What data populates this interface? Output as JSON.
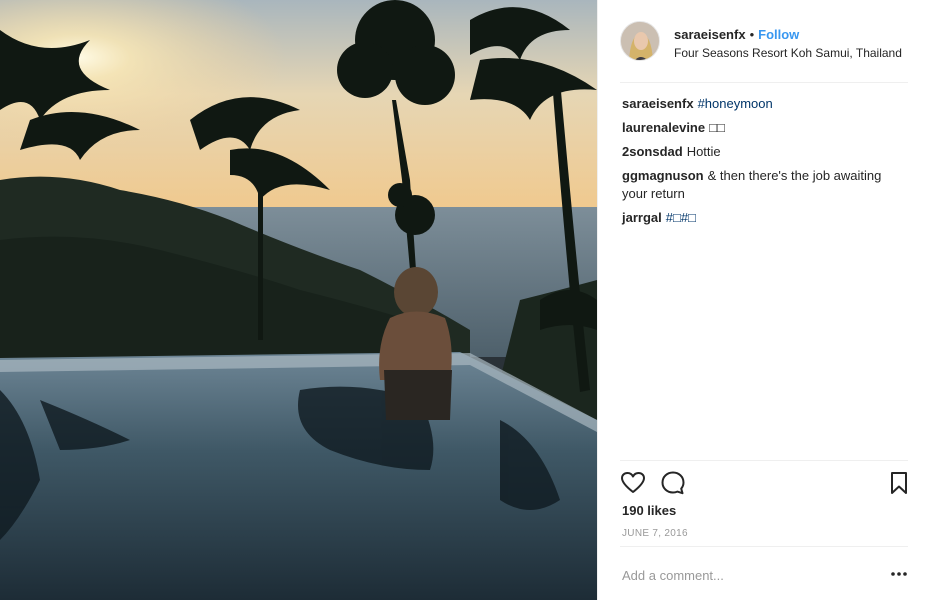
{
  "post": {
    "username": "saraeisenfx",
    "separator": "•",
    "follow_label": "Follow",
    "location": "Four Seasons Resort Koh Samui, Thailand",
    "comments": [
      {
        "user": "saraeisenfx",
        "text": "#honeymoon",
        "is_tag": true
      },
      {
        "user": "laurenalevine",
        "text": "□□",
        "is_tag": false
      },
      {
        "user": "2sonsdad",
        "text": "Hottie",
        "is_tag": false
      },
      {
        "user": "ggmagnuson",
        "text": "& then there's the job awaiting your return",
        "is_tag": false
      },
      {
        "user": "jarrgal",
        "text": "#□#□",
        "is_tag": true
      }
    ],
    "likes": "190 likes",
    "date": "JUNE 7, 2016",
    "comment_placeholder": "Add a comment...",
    "icons": [
      "heart-icon",
      "comment-bubble-icon",
      "bookmark-icon",
      "more-options-icon"
    ],
    "colors": {
      "follow": "#3897f0",
      "hashtag": "#003569",
      "muted": "#999999"
    }
  }
}
